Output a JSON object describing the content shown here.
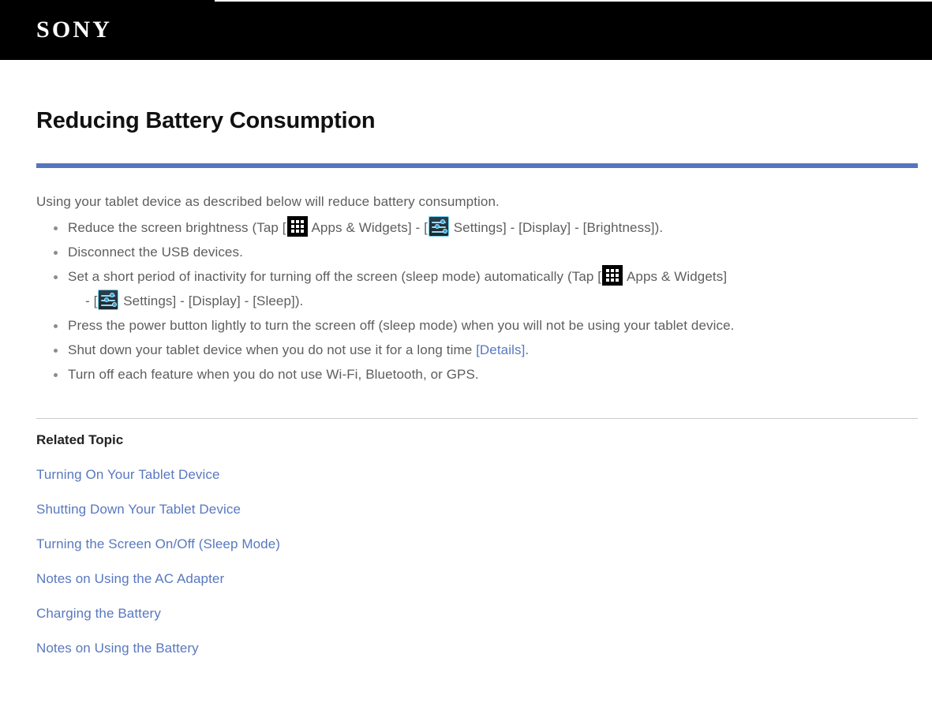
{
  "header": {
    "logo_text": "SONY",
    "logo_name": "sony-logo"
  },
  "page": {
    "title": "Reducing Battery Consumption",
    "intro": "Using your tablet device as described below will reduce battery consumption.",
    "accent_rule_color": "#5576bd",
    "separator_color": "#c9c9c9",
    "link_color": "#5878c0",
    "body_text_color": "#5e5e5e"
  },
  "icons": {
    "apps": "apps-grid-icon",
    "settings": "settings-sliders-icon"
  },
  "tips": [
    {
      "id": "reduce-brightness",
      "parts": [
        {
          "type": "text",
          "value": "Reduce the screen brightness (Tap ["
        },
        {
          "type": "icon",
          "value": "apps-grid-icon"
        },
        {
          "type": "text",
          "value": " Apps & Widgets] - ["
        },
        {
          "type": "icon",
          "value": "settings-sliders-icon"
        },
        {
          "type": "text",
          "value": " Settings] - [Display] - [Brightness])."
        }
      ],
      "t1": "Reduce the screen brightness (Tap [",
      "t2": " Apps & Widgets] - [",
      "t3": " Settings] - [Display] - [Brightness])."
    },
    {
      "id": "disconnect-usb",
      "t1": "Disconnect the USB devices."
    },
    {
      "id": "short-inactivity",
      "t1": "Set a short period of inactivity for turning off the screen (sleep mode) automatically (Tap [",
      "t2": " Apps & Widgets]",
      "t3": "- [",
      "t4": " Settings] - [Display] - [Sleep])."
    },
    {
      "id": "power-button-sleep",
      "t1": "Press the power button lightly to turn the screen off (sleep mode) when you will not be using your tablet device."
    },
    {
      "id": "shut-down",
      "t1": "Shut down your tablet device when you do not use it for a long time ",
      "link": "[Details]",
      "t2": "."
    },
    {
      "id": "turn-off-radios",
      "t1": "Turn off each feature when you do not use Wi-Fi, Bluetooth, or GPS."
    }
  ],
  "related": {
    "heading": "Related Topic",
    "links": [
      "Turning On Your Tablet Device",
      "Shutting Down Your Tablet Device",
      "Turning the Screen On/Off (Sleep Mode)",
      "Notes on Using the AC Adapter",
      "Charging the Battery",
      "Notes on Using the Battery"
    ]
  }
}
